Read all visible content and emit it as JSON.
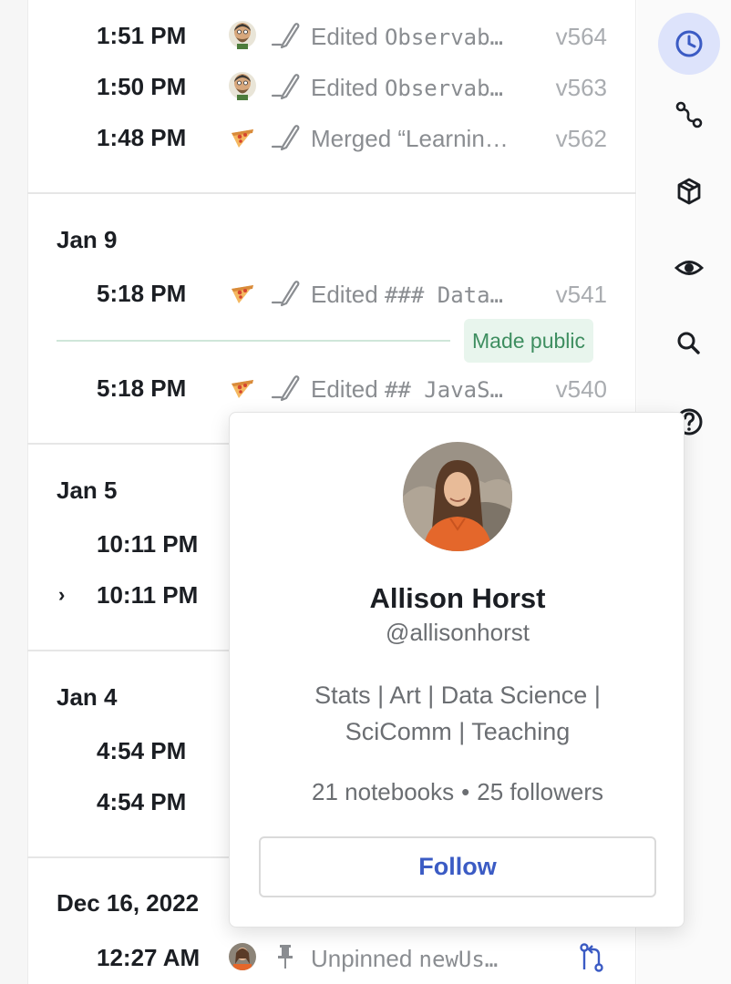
{
  "history": {
    "groups": [
      {
        "date": "",
        "rows": [
          {
            "time": "1:51 PM",
            "avatar": "illustrated-avatar",
            "action": "edit-icon",
            "desc_prefix": "Edited ",
            "desc_code": "Observab…",
            "desc_suffix": "",
            "version": "v564"
          },
          {
            "time": "1:50 PM",
            "avatar": "illustrated-avatar",
            "action": "edit-icon",
            "desc_prefix": "Edited ",
            "desc_code": "Observab…",
            "desc_suffix": "",
            "version": "v563"
          },
          {
            "time": "1:48 PM",
            "avatar": "pizza-avatar",
            "action": "edit-icon",
            "desc_prefix": "Merged “Learnin…",
            "desc_code": "",
            "desc_suffix": "",
            "version": "v562"
          }
        ]
      },
      {
        "date": "Jan 9",
        "rows": [
          {
            "time": "5:18 PM",
            "avatar": "pizza-avatar",
            "action": "edit-icon",
            "desc_prefix": "Edited ",
            "desc_code": "### Data…",
            "desc_suffix": "",
            "version": "v541"
          },
          {
            "time": "5:18 PM",
            "avatar": "pizza-avatar",
            "action": "edit-icon",
            "desc_prefix": "Edited ",
            "desc_code": "## JavaS…",
            "desc_suffix": "",
            "version": "v540"
          }
        ],
        "badge": "Made public"
      },
      {
        "date": "Jan 5",
        "rows": [
          {
            "time": "10:11 PM"
          },
          {
            "time": "10:11 PM",
            "expander": "›"
          }
        ]
      },
      {
        "date": "Jan 4",
        "rows": [
          {
            "time": "4:54 PM"
          },
          {
            "time": "4:54 PM"
          }
        ]
      },
      {
        "date": "Dec 16, 2022",
        "rows": [
          {
            "time": "12:27 AM",
            "avatar": "user-photo-avatar",
            "action": "pin-icon",
            "desc_prefix": "Unpinned ",
            "desc_code": "newUs…",
            "desc_suffix": "",
            "version": ""
          }
        ]
      }
    ]
  },
  "sidebar": {
    "buttons": [
      {
        "name": "history-icon",
        "active": true
      },
      {
        "name": "dependencies-icon",
        "active": false
      },
      {
        "name": "package-icon",
        "active": false
      },
      {
        "name": "eye-icon",
        "active": false
      },
      {
        "name": "search-icon",
        "active": false
      },
      {
        "name": "help-icon",
        "active": false
      }
    ]
  },
  "profile_popover": {
    "name": "Allison Horst",
    "handle": "@allisonhorst",
    "bio_line1": "Stats | Art | Data Science |",
    "bio_line2": "SciComm | Teaching",
    "notebooks": "21 notebooks",
    "separator": "•",
    "followers": "25 followers",
    "follow_label": "Follow"
  },
  "colors": {
    "accent": "#3b5bc4",
    "active_bg": "#dde3fb",
    "public_green": "#3e8e60",
    "muted_text": "#8a8d91"
  }
}
